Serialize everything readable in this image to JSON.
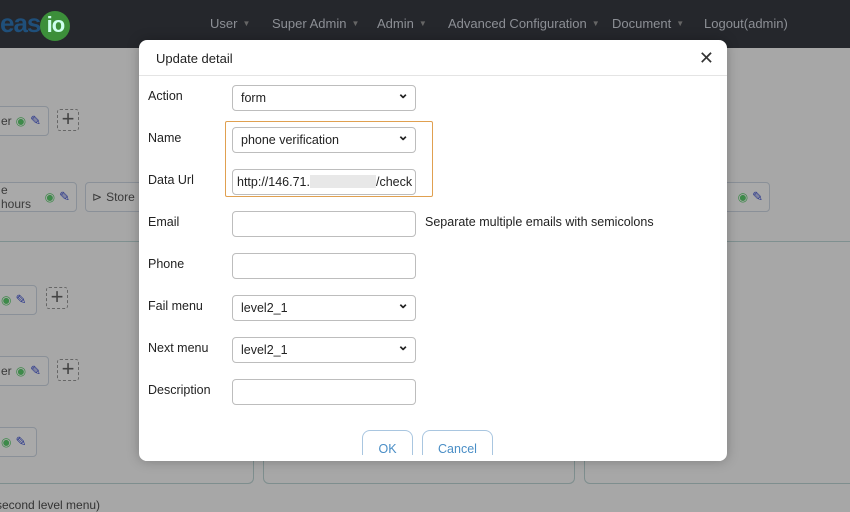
{
  "nav": {
    "logo_a": "eas",
    "logo_b": "io",
    "items": [
      "User",
      "Super Admin",
      "Admin",
      "Advanced Configuration",
      "Document"
    ],
    "logout": "Logout(admin)"
  },
  "background": {
    "chips": [
      "er",
      "e hours",
      "Store",
      "",
      "er",
      ""
    ],
    "footer_text": "second level menu)"
  },
  "modal": {
    "title": "Update detail",
    "fields": {
      "action": {
        "label": "Action",
        "value": "form"
      },
      "name": {
        "label": "Name",
        "value": "phone verification"
      },
      "data_url": {
        "label": "Data Url",
        "value_start": "http://146.71.",
        "value_end": "/check"
      },
      "email": {
        "label": "Email",
        "value": "",
        "help": "Separate multiple emails with semicolons"
      },
      "phone": {
        "label": "Phone",
        "value": ""
      },
      "fail_menu": {
        "label": "Fail menu",
        "value": "level2_1"
      },
      "next_menu": {
        "label": "Next menu",
        "value": "level2_1"
      },
      "description": {
        "label": "Description",
        "value": ""
      }
    },
    "ok": "OK",
    "cancel": "Cancel"
  },
  "colors": {
    "highlight": "#e0a050",
    "nav_bg": "#25272c",
    "button_text": "#4a8ec6"
  }
}
